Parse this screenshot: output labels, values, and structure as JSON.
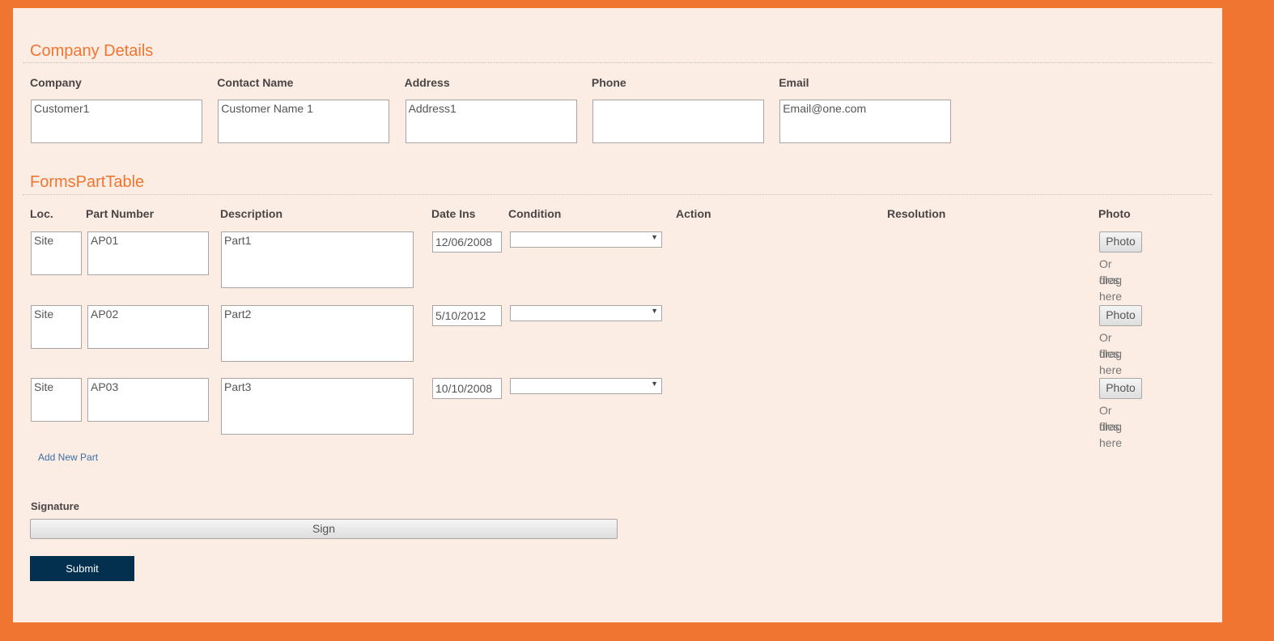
{
  "company": {
    "heading": "Company Details",
    "fields": [
      {
        "label": "Company",
        "value": "Customer1"
      },
      {
        "label": "Contact Name",
        "value": "Customer Name 1"
      },
      {
        "label": "Address",
        "value": "Address1"
      },
      {
        "label": "Phone",
        "value": ""
      },
      {
        "label": "Email",
        "value": "Email@one.com"
      }
    ]
  },
  "parts": {
    "heading": "FormsPartTable",
    "columns": [
      "Loc.",
      "Part Number",
      "Description",
      "Date Ins",
      "Condition",
      "Action",
      "Resolution",
      "Photo"
    ],
    "rows": [
      {
        "loc": "Site",
        "part": "AP01",
        "desc": "Part1",
        "date": "12/06/2008",
        "condition": ""
      },
      {
        "loc": "Site",
        "part": "AP02",
        "desc": "Part2",
        "date": "5/10/2012",
        "condition": ""
      },
      {
        "loc": "Site",
        "part": "AP03",
        "desc": "Part3",
        "date": "10/10/2008",
        "condition": ""
      }
    ],
    "photo_button": "Photo",
    "drag_line1": "Or drag",
    "drag_line2": "files here",
    "add_link": "Add New Part"
  },
  "signature": {
    "label": "Signature",
    "button": "Sign"
  },
  "submit": "Submit"
}
